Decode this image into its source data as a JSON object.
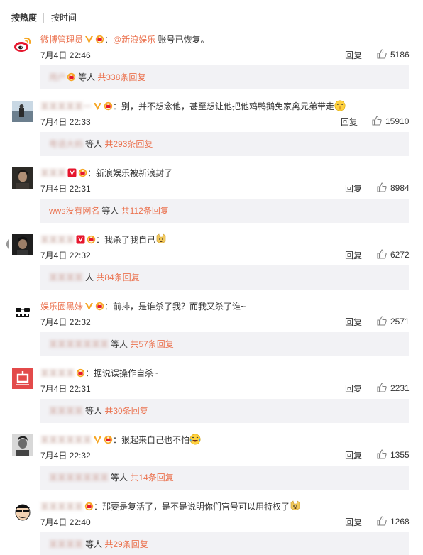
{
  "tabs": {
    "hot": "按热度",
    "time": "按时间"
  },
  "labels": {
    "reply": "回复"
  },
  "colors": {
    "accent": "#eb7350",
    "reply_bg": "#f2f2f5",
    "verified_gold": "#f6a623",
    "verified_red": "#e6162d"
  },
  "comments": [
    {
      "name": "微博管理员",
      "badge": "verified-gold",
      "colon": "：",
      "mention": "@新浪娱乐",
      "text": " 账号已恢复。",
      "emoji": "",
      "time": "7月4日 22:46",
      "likes": "5186",
      "reply_names": "用户",
      "reply_mid": "等人",
      "reply_count": "共338条回复"
    },
    {
      "name": "某某某某某一",
      "badge": "verified-gold",
      "colon": "：",
      "mention": "",
      "text": "别，并不想念他，甚至想让他把他鸡鸭鹅免家禽兄弟带走",
      "emoji": "shush-face-emoji",
      "time": "7月4日 22:33",
      "likes": "15910",
      "reply_names": "粤语大蚂",
      "reply_mid": "等人",
      "reply_count": "共293条回复"
    },
    {
      "name": "某某某",
      "badge": "verified-red",
      "colon": "：",
      "mention": "",
      "text": "新浪娱乐被新浪封了",
      "emoji": "",
      "time": "7月4日 22:31",
      "likes": "8984",
      "reply_names": "wws没有网名",
      "reply_names_clear": true,
      "reply_mid": "等人",
      "reply_count": "共112条回复"
    },
    {
      "name": "某某某某",
      "badge": "verified-red",
      "colon": "：",
      "mention": "",
      "text": "我杀了我自己",
      "emoji": "doge-emoji",
      "time": "7月4日 22:32",
      "likes": "6272",
      "reply_names": "某某某某",
      "reply_mid": "人",
      "reply_count": "共84条回复"
    },
    {
      "name": "娱乐圈黑妹",
      "badge": "verified-gold",
      "colon": "：",
      "mention": "",
      "text": "前排，是谁杀了我？而我又杀了谁~",
      "emoji": "",
      "time": "7月4日 22:32",
      "likes": "2571",
      "reply_names": "某某某某某某某",
      "reply_mid": "等人",
      "reply_count": "共57条回复"
    },
    {
      "name": "某某某某",
      "badge": "",
      "colon": "：",
      "mention": "",
      "text": "据说误操作自杀~",
      "emoji": "",
      "time": "7月4日 22:31",
      "likes": "2231",
      "reply_names": "某某某某",
      "reply_mid": "等人",
      "reply_count": "共30条回复"
    },
    {
      "name": "某某某某某某",
      "badge": "verified-gold",
      "colon": "：",
      "mention": "",
      "text": "狠起来自己也不怕",
      "emoji": "laugh-cry-emoji",
      "time": "7月4日 22:32",
      "likes": "1355",
      "reply_names": "某某某某某某某",
      "reply_mid": "等人",
      "reply_count": "共14条回复"
    },
    {
      "name": "某某某某某",
      "badge": "",
      "colon": "：",
      "mention": "",
      "text": "那要是复活了，是不是说明你们官号可以用特权了",
      "emoji": "doge-emoji",
      "time": "7月4日 22:40",
      "likes": "1268",
      "reply_names": "某某某某",
      "reply_mid": "等人",
      "reply_count": "共29条回复"
    }
  ]
}
